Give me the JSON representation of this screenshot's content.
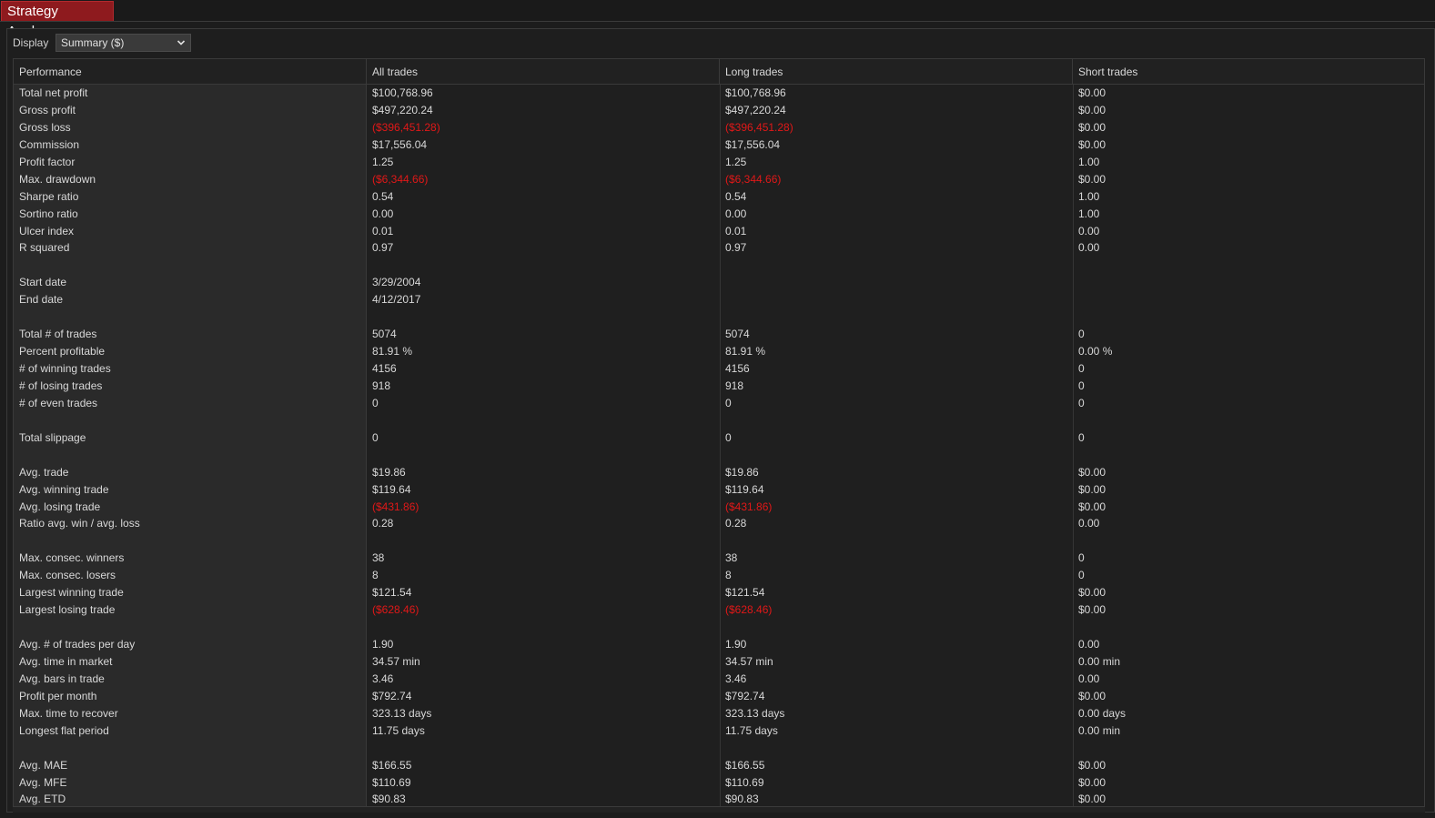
{
  "app": {
    "tab_title": "Strategy Analyzer"
  },
  "display": {
    "label": "Display",
    "selected": "Summary ($)"
  },
  "columns": [
    "Performance",
    "All trades",
    "Long trades",
    "Short trades"
  ],
  "colors": {
    "negative": "#e01818",
    "tab_bg": "#8e1a1e"
  },
  "rows": [
    [
      "Total net profit",
      "$100,768.96",
      "$100,768.96",
      "$0.00"
    ],
    [
      "Gross profit",
      "$497,220.24",
      "$497,220.24",
      "$0.00"
    ],
    [
      "Gross loss",
      "($396,451.28)",
      "($396,451.28)",
      "$0.00"
    ],
    [
      "Commission",
      "$17,556.04",
      "$17,556.04",
      "$0.00"
    ],
    [
      "Profit factor",
      "1.25",
      "1.25",
      "1.00"
    ],
    [
      "Max. drawdown",
      "($6,344.66)",
      "($6,344.66)",
      "$0.00"
    ],
    [
      "Sharpe ratio",
      "0.54",
      "0.54",
      "1.00"
    ],
    [
      "Sortino ratio",
      "0.00",
      "0.00",
      "1.00"
    ],
    [
      "Ulcer index",
      "0.01",
      "0.01",
      "0.00"
    ],
    [
      "R squared",
      "0.97",
      "0.97",
      "0.00"
    ],
    [
      "",
      "",
      "",
      ""
    ],
    [
      "Start date",
      "3/29/2004",
      "",
      ""
    ],
    [
      "End date",
      "4/12/2017",
      "",
      ""
    ],
    [
      "",
      "",
      "",
      ""
    ],
    [
      "Total # of trades",
      "5074",
      "5074",
      "0"
    ],
    [
      "Percent profitable",
      "81.91 %",
      "81.91 %",
      "0.00 %"
    ],
    [
      "# of winning trades",
      "4156",
      "4156",
      "0"
    ],
    [
      "# of losing trades",
      "918",
      "918",
      "0"
    ],
    [
      "# of even trades",
      "0",
      "0",
      "0"
    ],
    [
      "",
      "",
      "",
      ""
    ],
    [
      "Total slippage",
      "0",
      "0",
      "0"
    ],
    [
      "",
      "",
      "",
      ""
    ],
    [
      "Avg. trade",
      "$19.86",
      "$19.86",
      "$0.00"
    ],
    [
      "Avg. winning trade",
      "$119.64",
      "$119.64",
      "$0.00"
    ],
    [
      "Avg. losing trade",
      "($431.86)",
      "($431.86)",
      "$0.00"
    ],
    [
      "Ratio avg. win / avg. loss",
      "0.28",
      "0.28",
      "0.00"
    ],
    [
      "",
      "",
      "",
      ""
    ],
    [
      "Max. consec. winners",
      "38",
      "38",
      "0"
    ],
    [
      "Max. consec. losers",
      "8",
      "8",
      "0"
    ],
    [
      "Largest winning trade",
      "$121.54",
      "$121.54",
      "$0.00"
    ],
    [
      "Largest losing trade",
      "($628.46)",
      "($628.46)",
      "$0.00"
    ],
    [
      "",
      "",
      "",
      ""
    ],
    [
      "Avg. # of trades per day",
      "1.90",
      "1.90",
      "0.00"
    ],
    [
      "Avg. time in market",
      "34.57 min",
      "34.57 min",
      "0.00 min"
    ],
    [
      "Avg. bars in trade",
      "3.46",
      "3.46",
      "0.00"
    ],
    [
      "Profit per month",
      "$792.74",
      "$792.74",
      "$0.00"
    ],
    [
      "Max. time to recover",
      "323.13 days",
      "323.13 days",
      "0.00 days"
    ],
    [
      "Longest flat period",
      "11.75 days",
      "11.75 days",
      "0.00 min"
    ],
    [
      "",
      "",
      "",
      ""
    ],
    [
      "Avg. MAE",
      "$166.55",
      "$166.55",
      "$0.00"
    ],
    [
      "Avg. MFE",
      "$110.69",
      "$110.69",
      "$0.00"
    ],
    [
      "Avg. ETD",
      "$90.83",
      "$90.83",
      "$0.00"
    ]
  ]
}
